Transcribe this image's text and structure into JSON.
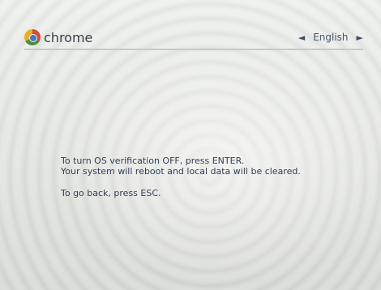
{
  "header": {
    "brand": "chrome",
    "language": "English",
    "prev_arrow": "◄",
    "next_arrow": "►"
  },
  "message": {
    "line1": "To turn OS verification OFF, press ENTER.",
    "line2": "Your system will reboot and local data will be cleared.",
    "line3": "To go back, press ESC."
  },
  "icons": {
    "logo": "chrome-logo-icon",
    "prev": "chevron-left-icon",
    "next": "chevron-right-icon"
  },
  "colors": {
    "text": "#2f3f55",
    "accent": "#43566e"
  }
}
